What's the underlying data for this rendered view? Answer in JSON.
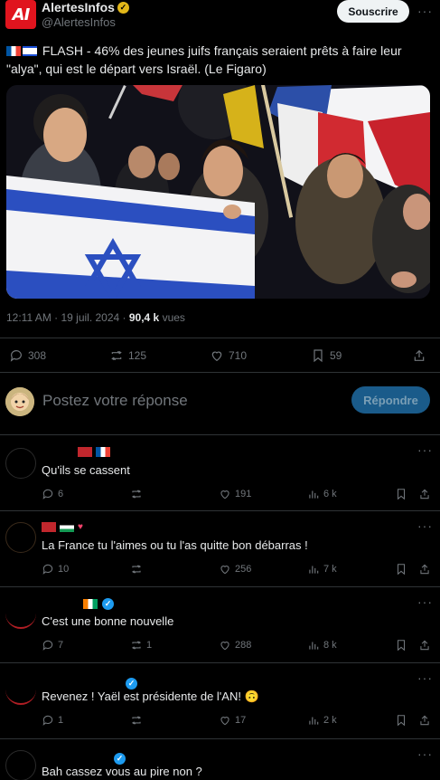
{
  "post": {
    "author_name": "AlertesInfos",
    "author_handle": "@AlertesInfos",
    "avatar_letters": "AI",
    "subscribe_label": "Souscrire",
    "text": "FLASH - 46% des jeunes juifs français seraient prêts à faire leur \"alya\", qui est le départ vers Israël. (Le Figaro)",
    "timestamp": "12:11 AM · 19 juil. 2024 · ",
    "views_count": "90,4 k",
    "views_label": " vues",
    "replies": "308",
    "reposts": "125",
    "likes": "710",
    "bookmarks": "59"
  },
  "composer": {
    "placeholder": "Postez votre réponse",
    "reply_button": "Répondre"
  },
  "replies": [
    {
      "text": "Qu'ils se cassent",
      "replies": "6",
      "reposts": "",
      "likes": "191",
      "views": "6 k"
    },
    {
      "text": "La France tu l'aimes ou tu l'as quitte bon débarras !",
      "replies": "10",
      "reposts": "",
      "likes": "256",
      "views": "7 k"
    },
    {
      "text": "C'est une bonne nouvelle",
      "replies": "7",
      "reposts": "1",
      "likes": "288",
      "views": "8 k"
    },
    {
      "text": "Revenez ! Yaël est présidente de l'AN! 🙃",
      "replies": "1",
      "reposts": "",
      "likes": "17",
      "views": "2 k"
    },
    {
      "text": "Bah cassez vous au pire non ?",
      "replies": "",
      "reposts": "",
      "likes": "",
      "views": ""
    }
  ],
  "colors": {
    "background": "#000000",
    "accent": "#1d9bf0",
    "verified_gold": "#e2b719",
    "muted": "#71767b"
  }
}
